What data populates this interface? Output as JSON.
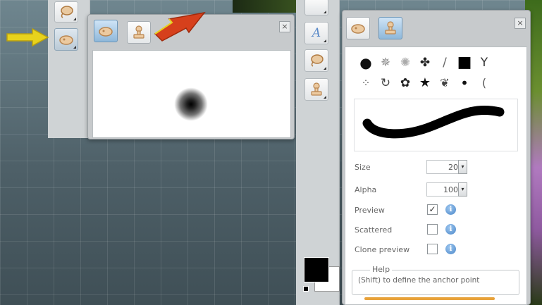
{
  "left_panel": {
    "tabs": [
      {
        "icon": "stamp-shape-icon",
        "selected": true
      },
      {
        "icon": "clone-stamp-icon",
        "selected": false
      }
    ],
    "close_label": "×"
  },
  "right_panel": {
    "tabs": [
      {
        "icon": "stamp-shape-icon",
        "selected": false
      },
      {
        "icon": "clone-stamp-icon",
        "selected": true
      }
    ],
    "close_label": "×",
    "brushes": [
      {
        "name": "round-hard",
        "glyph": "●"
      },
      {
        "name": "sparkle",
        "glyph": "✵"
      },
      {
        "name": "soft-round",
        "glyph": "✺"
      },
      {
        "name": "splat",
        "glyph": "✤"
      },
      {
        "name": "stroke",
        "glyph": "/"
      },
      {
        "name": "square",
        "glyph": "■"
      },
      {
        "name": "grass",
        "glyph": "Y"
      },
      {
        "name": "dashed",
        "glyph": "⁘"
      },
      {
        "name": "swirl",
        "glyph": "↻"
      },
      {
        "name": "flower",
        "glyph": "✿"
      },
      {
        "name": "star",
        "glyph": "★"
      },
      {
        "name": "leaves",
        "glyph": "❦"
      },
      {
        "name": "dot-small",
        "glyph": "•"
      },
      {
        "name": "wisp",
        "glyph": "("
      }
    ],
    "options": {
      "size_label": "Size",
      "size_value": "20",
      "alpha_label": "Alpha",
      "alpha_value": "100",
      "spin_glyph": "▾",
      "preview_label": "Preview",
      "preview_checked": true,
      "scattered_label": "Scattered",
      "scattered_checked": false,
      "clone_preview_label": "Clone preview",
      "clone_preview_checked": false,
      "info_glyph": "i",
      "check_glyph": "✓"
    },
    "help": {
      "legend": "Help",
      "text": "(Shift) to define the anchor point"
    }
  },
  "colors": {
    "foreground": "#000000",
    "background": "#ffffff",
    "arrow_yellow": "#e8d21c",
    "arrow_red": "#d6401c",
    "accent_orange": "#e8a23a"
  }
}
